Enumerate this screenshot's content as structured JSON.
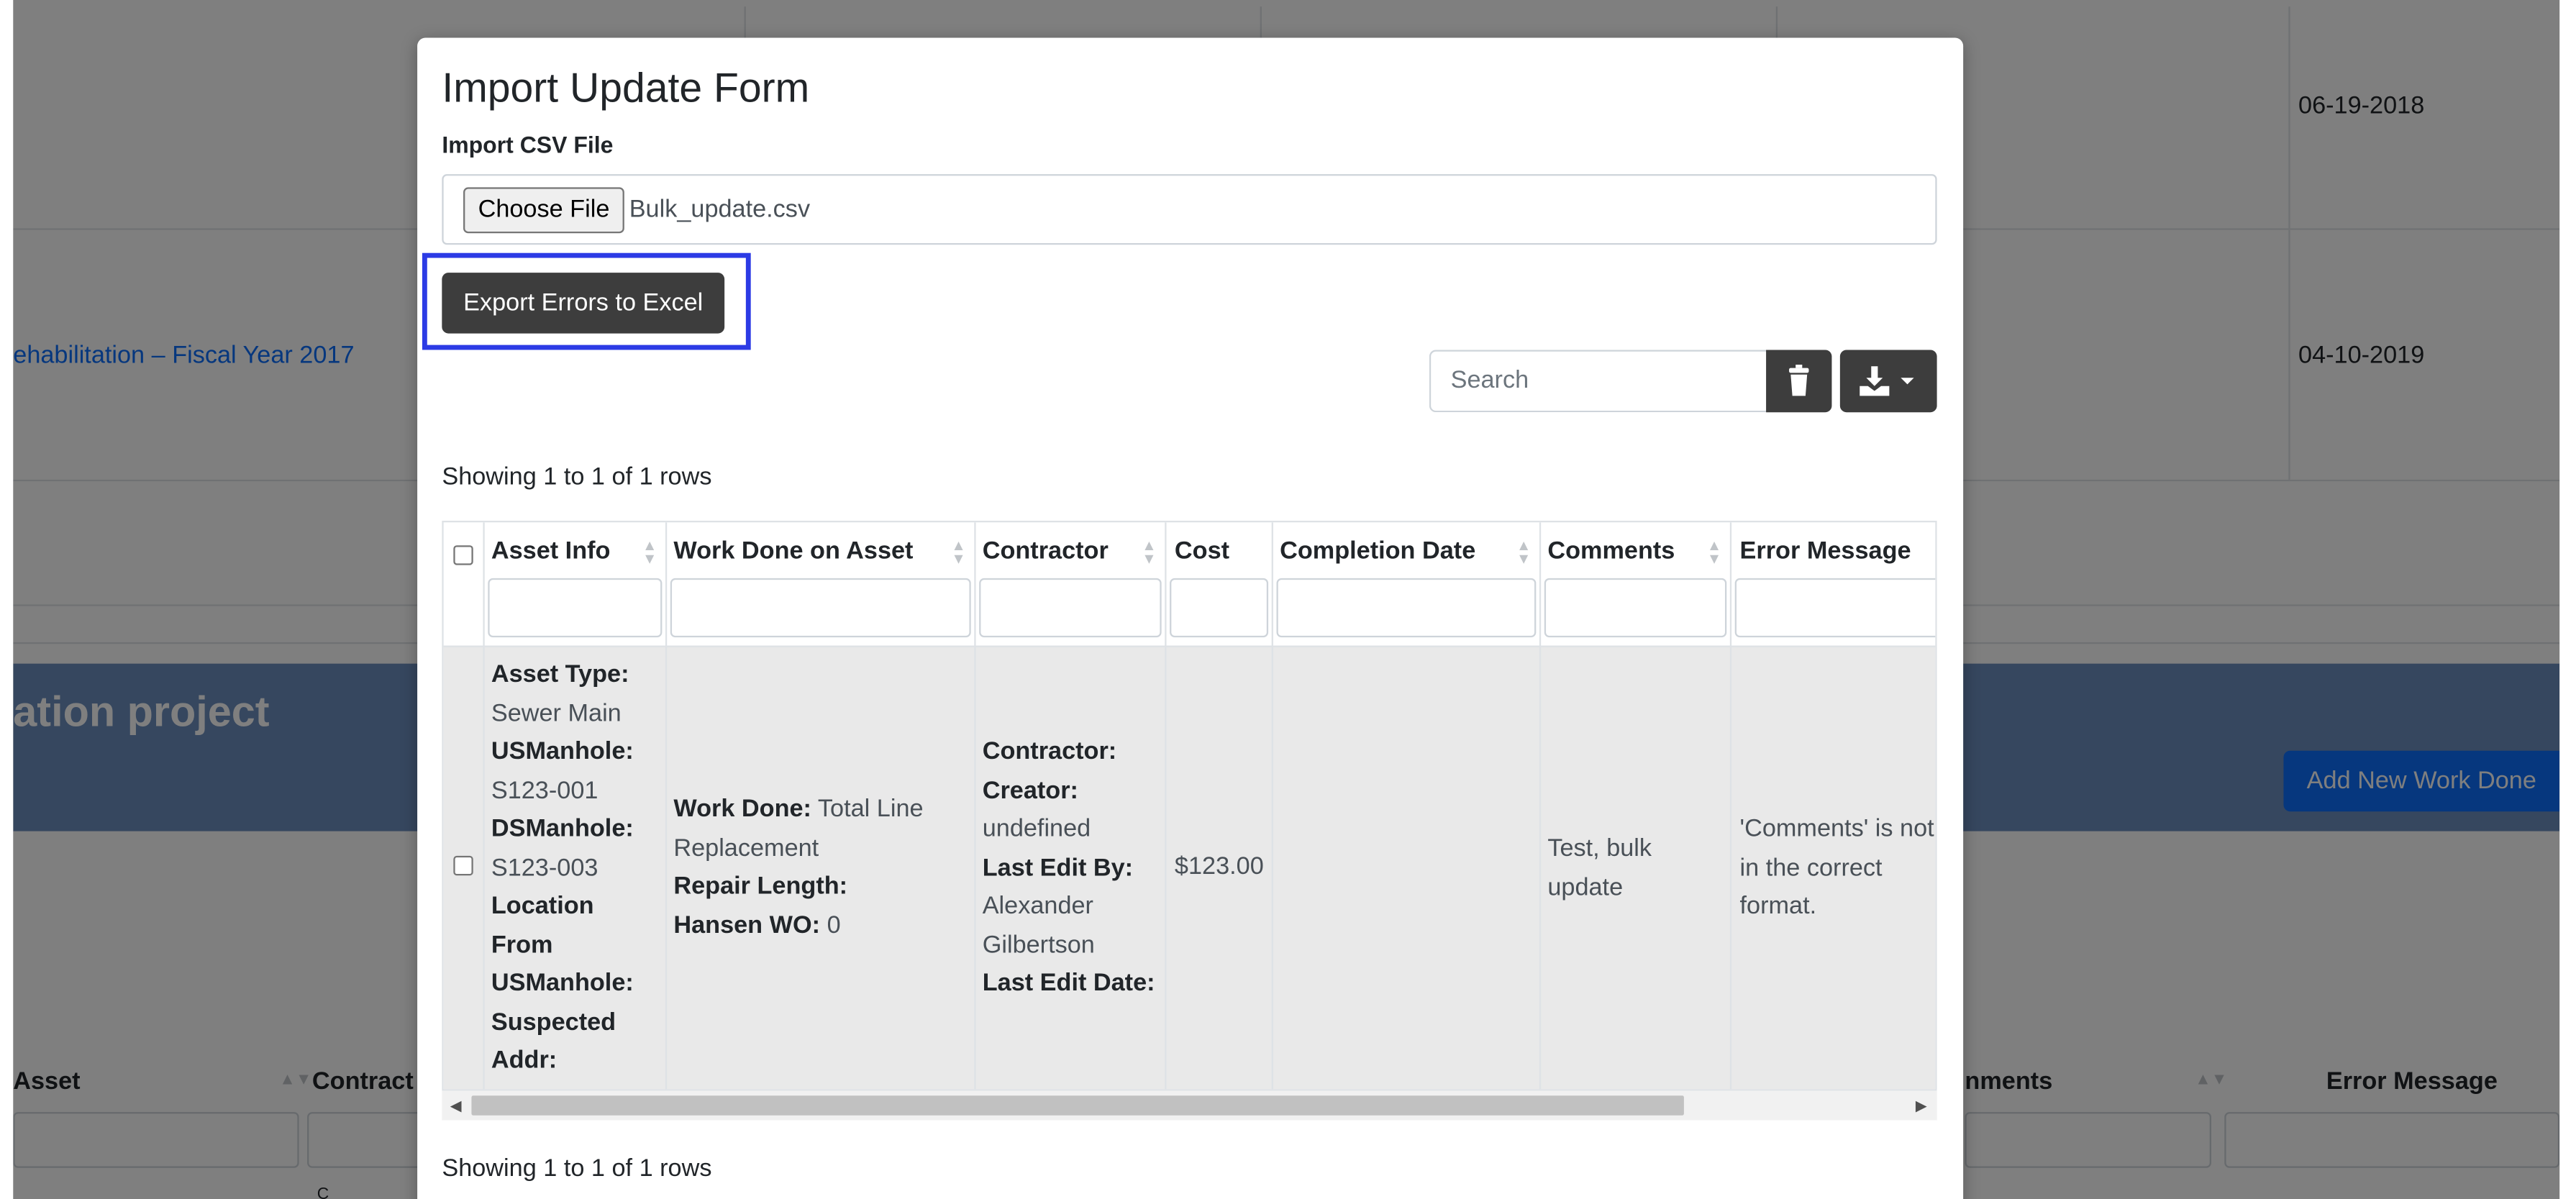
{
  "background": {
    "dates": [
      "06-19-2018",
      "04-10-2019"
    ],
    "project_link": "ehabilitation – Fiscal Year 2017",
    "banner_title": "ation project",
    "add_button": "Add New Work Done",
    "table_headers": [
      "Asset",
      "Contract",
      "nments",
      "Error Message"
    ]
  },
  "modal": {
    "title": "Import Update Form",
    "file_label": "Import CSV File",
    "choose_file_label": "Choose File",
    "file_name": "Bulk_update.csv",
    "export_button": "Export Errors to Excel",
    "search_placeholder": "Search",
    "trash_icon": "trash-icon",
    "download_icon": "download-icon",
    "showing_top": "Showing 1 to 1 of 1 rows",
    "showing_bottom": "Showing 1 to 1 of 1 rows",
    "table": {
      "columns": [
        "Asset Info",
        "Work Done on Asset",
        "Contractor",
        "Cost",
        "Completion Date",
        "Comments",
        "Error Message"
      ],
      "row": {
        "asset_info": [
          {
            "label": "Asset Type:",
            "value": "Sewer Main"
          },
          {
            "label": "USManhole:",
            "value": "S123-001"
          },
          {
            "label": "DSManhole:",
            "value": "S123-003"
          },
          {
            "label": "Location From USManhole:",
            "value": ""
          },
          {
            "label": "Suspected Addr:",
            "value": ""
          }
        ],
        "work_done": [
          {
            "label": "Work Done:",
            "value": "Total Line Replacement"
          },
          {
            "label": "Repair Length:",
            "value": ""
          },
          {
            "label": "Hansen WO:",
            "value": "0"
          }
        ],
        "contractor": [
          {
            "label": "Contractor:",
            "value": ""
          },
          {
            "label": "Creator:",
            "value": "undefined"
          },
          {
            "label": "Last Edit By:",
            "value": "Alexander Gilbertson"
          },
          {
            "label": "Last Edit Date:",
            "value": ""
          }
        ],
        "cost": "$123.00",
        "completion_date": "",
        "comments": "Test, bulk update",
        "error_message": "'Comments' is not in the correct format."
      }
    }
  },
  "colors": {
    "highlight": "#2c3be5",
    "dark_button": "#3d3d3d",
    "link": "#0d6efd",
    "row_bg": "#e9e9e9"
  }
}
